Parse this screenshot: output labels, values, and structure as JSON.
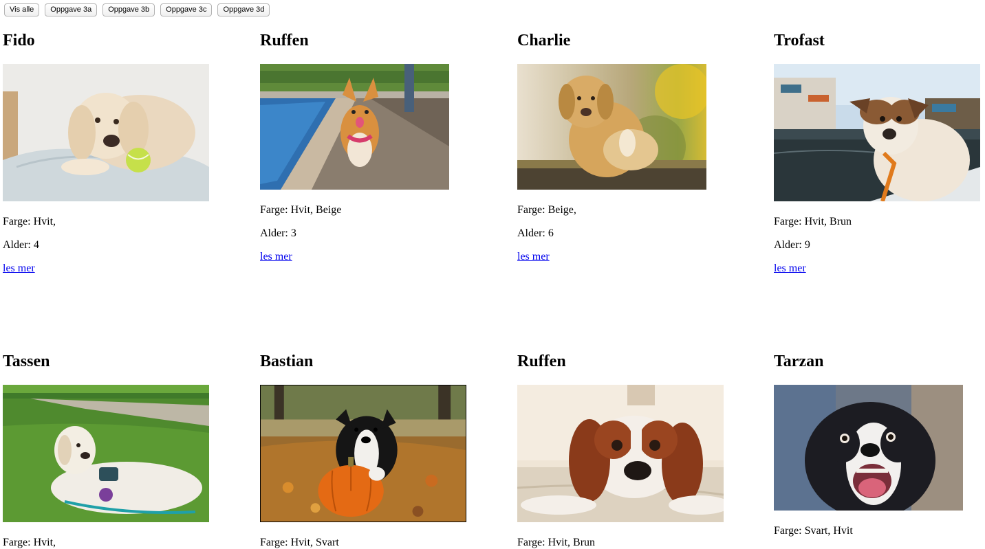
{
  "toolbar": {
    "buttons": [
      "Vis alle",
      "Oppgave 3a",
      "Oppgave 3b",
      "Oppgave 3c",
      "Oppgave 3d"
    ]
  },
  "dogs": [
    {
      "name": "Fido",
      "color_text": "Farge: Hvit,",
      "age_text": "Alder: 4",
      "link": "les mer",
      "photo": "golden-retriever-with-tennis-ball-photo"
    },
    {
      "name": "Ruffen",
      "color_text": "Farge: Hvit, Beige",
      "age_text": "Alder: 3",
      "link": "les mer",
      "photo": "corgi-on-pier-photo"
    },
    {
      "name": "Charlie",
      "color_text": "Farge: Beige,",
      "age_text": "Alder: 6",
      "link": "les mer",
      "photo": "labrador-sitting-photo"
    },
    {
      "name": "Trofast",
      "color_text": "Farge: Hvit, Brun",
      "age_text": "Alder: 9",
      "link": "les mer",
      "photo": "dog-on-boat-photo"
    },
    {
      "name": "Tassen",
      "color_text": "Farge: Hvit,",
      "photo": "retriever-lying-on-grass-photo"
    },
    {
      "name": "Bastian",
      "color_text": "Farge: Hvit, Svart",
      "photo": "puppy-with-pumpkin-photo"
    },
    {
      "name": "Ruffen",
      "color_text": "Farge: Hvit, Brun",
      "photo": "spaniel-lying-on-carpet-photo"
    },
    {
      "name": "Tarzan",
      "color_text": "Farge: Svart, Hvit",
      "photo": "black-white-dog-closeup-photo"
    }
  ],
  "colors": {
    "link": "#0000ee"
  }
}
